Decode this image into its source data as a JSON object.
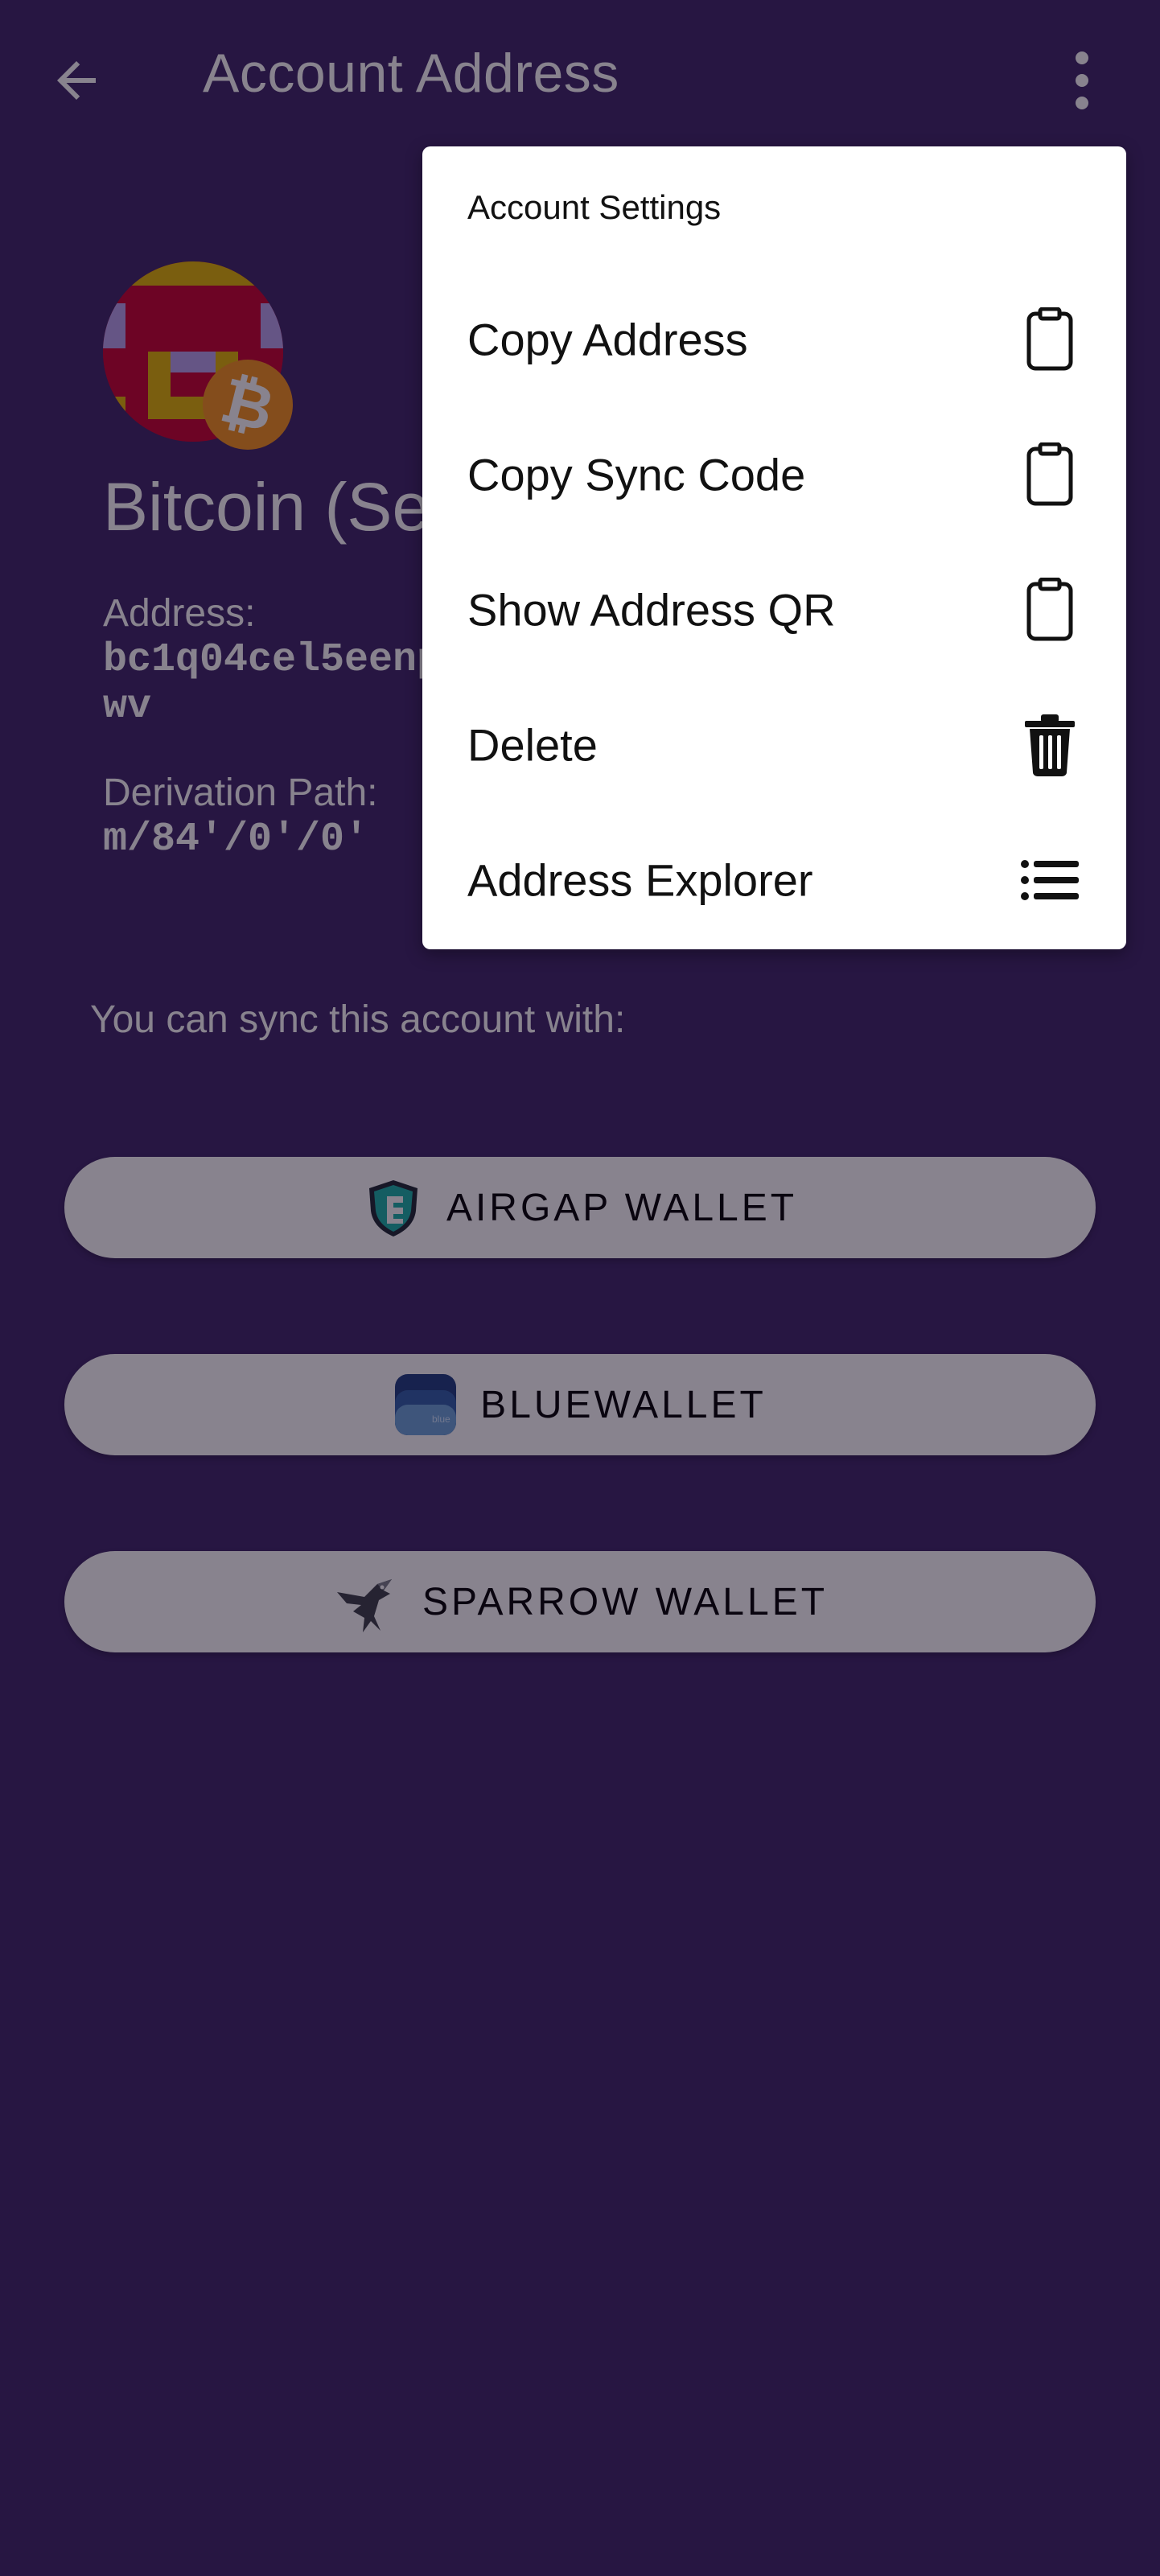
{
  "header": {
    "title": "Account Address"
  },
  "account": {
    "name": "Bitcoin (Se",
    "address_label": "Address:",
    "address_line1": "bc1q04cel5eenp",
    "address_line2": "wv",
    "derivation_label": "Derivation Path:",
    "derivation_value": "m/84'/0'/0'"
  },
  "sync": {
    "intro": "You can sync this account with:",
    "wallets": [
      {
        "label": "AIRGAP WALLET",
        "icon": "airgap-shield-icon"
      },
      {
        "label": "BLUEWALLET",
        "icon": "bluewallet-icon"
      },
      {
        "label": "SPARROW WALLET",
        "icon": "sparrow-bird-icon"
      }
    ]
  },
  "menu": {
    "header": "Account Settings",
    "items": [
      {
        "label": "Copy Address",
        "icon": "clipboard-icon"
      },
      {
        "label": "Copy Sync Code",
        "icon": "clipboard-icon"
      },
      {
        "label": "Show Address QR",
        "icon": "clipboard-icon"
      },
      {
        "label": "Delete",
        "icon": "trash-icon"
      },
      {
        "label": "Address Explorer",
        "icon": "list-icon"
      }
    ]
  },
  "colors": {
    "background": "#3c2466",
    "bitcoin_orange": "#f7931a",
    "avatar_red": "#c8002c",
    "avatar_gold": "#e2b400",
    "avatar_lavender": "#b8a2ec"
  }
}
